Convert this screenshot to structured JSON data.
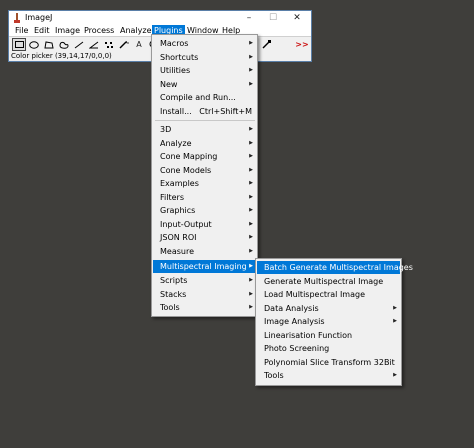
{
  "window": {
    "title": "ImageJ",
    "controls": {
      "minimize": "–",
      "maximize": "☐",
      "close": "✕"
    },
    "status": "Color picker (39,14,17/0,0,0)"
  },
  "menubar": [
    "File",
    "Edit",
    "Image",
    "Process",
    "Analyze",
    "Plugins",
    "Window",
    "Help"
  ],
  "active_menu": "Plugins",
  "toolbar": {
    "icons": [
      "rectangle-tool-icon",
      "oval-tool-icon",
      "polygon-tool-icon",
      "freehand-tool-icon",
      "line-tool-icon",
      "angle-tool-icon",
      "point-tool-icon",
      "wand-tool-icon",
      "text-tool-icon",
      "zoom-tool-icon",
      "dropper-tool-icon",
      "more-tools-icon"
    ],
    "text_tool_glyph": "A",
    "more_tools_glyph": ">>"
  },
  "plugins_menu": {
    "items": [
      {
        "label": "Macros",
        "submenu": true
      },
      {
        "label": "Shortcuts",
        "submenu": true
      },
      {
        "label": "Utilities",
        "submenu": true
      },
      {
        "label": "New",
        "submenu": true
      },
      {
        "label": "Compile and Run...",
        "submenu": false
      },
      {
        "label": "Install...",
        "accelerator": "Ctrl+Shift+M",
        "submenu": false
      },
      {
        "label": "3D",
        "submenu": true
      },
      {
        "label": "Analyze",
        "submenu": true
      },
      {
        "label": "Cone Mapping",
        "submenu": true
      },
      {
        "label": "Cone Models",
        "submenu": true
      },
      {
        "label": "Examples",
        "submenu": true
      },
      {
        "label": "Filters",
        "submenu": true
      },
      {
        "label": "Graphics",
        "submenu": true
      },
      {
        "label": "Input-Output",
        "submenu": true
      },
      {
        "label": "JSON ROI",
        "submenu": true
      },
      {
        "label": "Measure",
        "submenu": true
      },
      {
        "label": "Multispectral Imaging",
        "submenu": true,
        "highlighted": true
      },
      {
        "label": "Scripts",
        "submenu": true
      },
      {
        "label": "Stacks",
        "submenu": true
      },
      {
        "label": "Tools",
        "submenu": true
      }
    ]
  },
  "multispectral_menu": {
    "items": [
      {
        "label": "Batch Generate Multispectral Images",
        "submenu": false,
        "highlighted": true
      },
      {
        "label": "Generate Multispectral Image",
        "submenu": false
      },
      {
        "label": "Load Multispectral Image",
        "submenu": false
      },
      {
        "label": "Data Analysis",
        "submenu": true
      },
      {
        "label": "Image Analysis",
        "submenu": true
      },
      {
        "label": "Linearisation Function",
        "submenu": false
      },
      {
        "label": "Photo Screening",
        "submenu": false
      },
      {
        "label": "Polynomial Slice Transform 32Bit",
        "submenu": false
      },
      {
        "label": "Tools",
        "submenu": true
      }
    ]
  },
  "colors": {
    "highlight": "#0078d7",
    "desktop": "#3f3e3b",
    "menu_bg": "#f0f0f0",
    "more_tools": "#cc1111"
  }
}
